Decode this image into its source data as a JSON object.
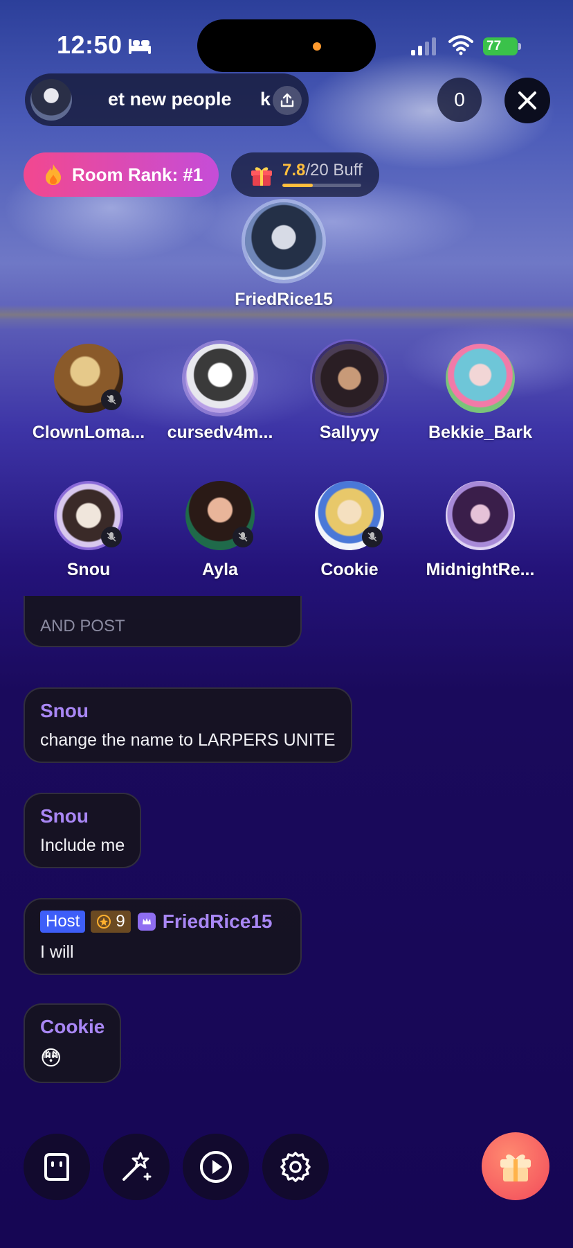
{
  "status_bar": {
    "time": "12:50",
    "battery": "77"
  },
  "room": {
    "title_scroll": "et new people",
    "title_scroll_next": "k",
    "listener_count": "0",
    "rank_label": "Room Rank: #1",
    "buff_value": "7.8",
    "buff_total": "/20 Buff",
    "buff_progress": 0.39
  },
  "host_seat": {
    "name": "FriedRice15"
  },
  "seats": [
    {
      "name": "ClownLoma...",
      "muted": true
    },
    {
      "name": "cursedv4m...",
      "muted": false
    },
    {
      "name": "Sallyyy",
      "muted": false
    },
    {
      "name": "Bekkie_Bark",
      "muted": false
    },
    {
      "name": "Snou",
      "muted": true
    },
    {
      "name": "Ayla",
      "muted": true
    },
    {
      "name": "Cookie",
      "muted": true
    },
    {
      "name": "MidnightRe...",
      "muted": false
    }
  ],
  "chat": {
    "faded_message": "AND POST",
    "messages": [
      {
        "name": "Snou",
        "text": "change the name to LARPERS UNITE"
      },
      {
        "name": "Snou",
        "text": "Include me"
      },
      {
        "host_badge": "Host",
        "level": "9",
        "name": "FriedRice15",
        "text": "I will"
      },
      {
        "name": "Cookie",
        "text": "😳"
      }
    ]
  },
  "icons": {
    "bottom_bar": [
      "chat-face-icon",
      "magic-wand-icon",
      "play-icon",
      "settings-gear-icon",
      "gift-icon"
    ]
  },
  "colors": {
    "accent_purple": "#a987f5",
    "host_blue": "#3e5ef8",
    "rank_pink": "#f2488f",
    "buff_gold": "#ffbe3d",
    "gift_red": "#f24a5a"
  }
}
